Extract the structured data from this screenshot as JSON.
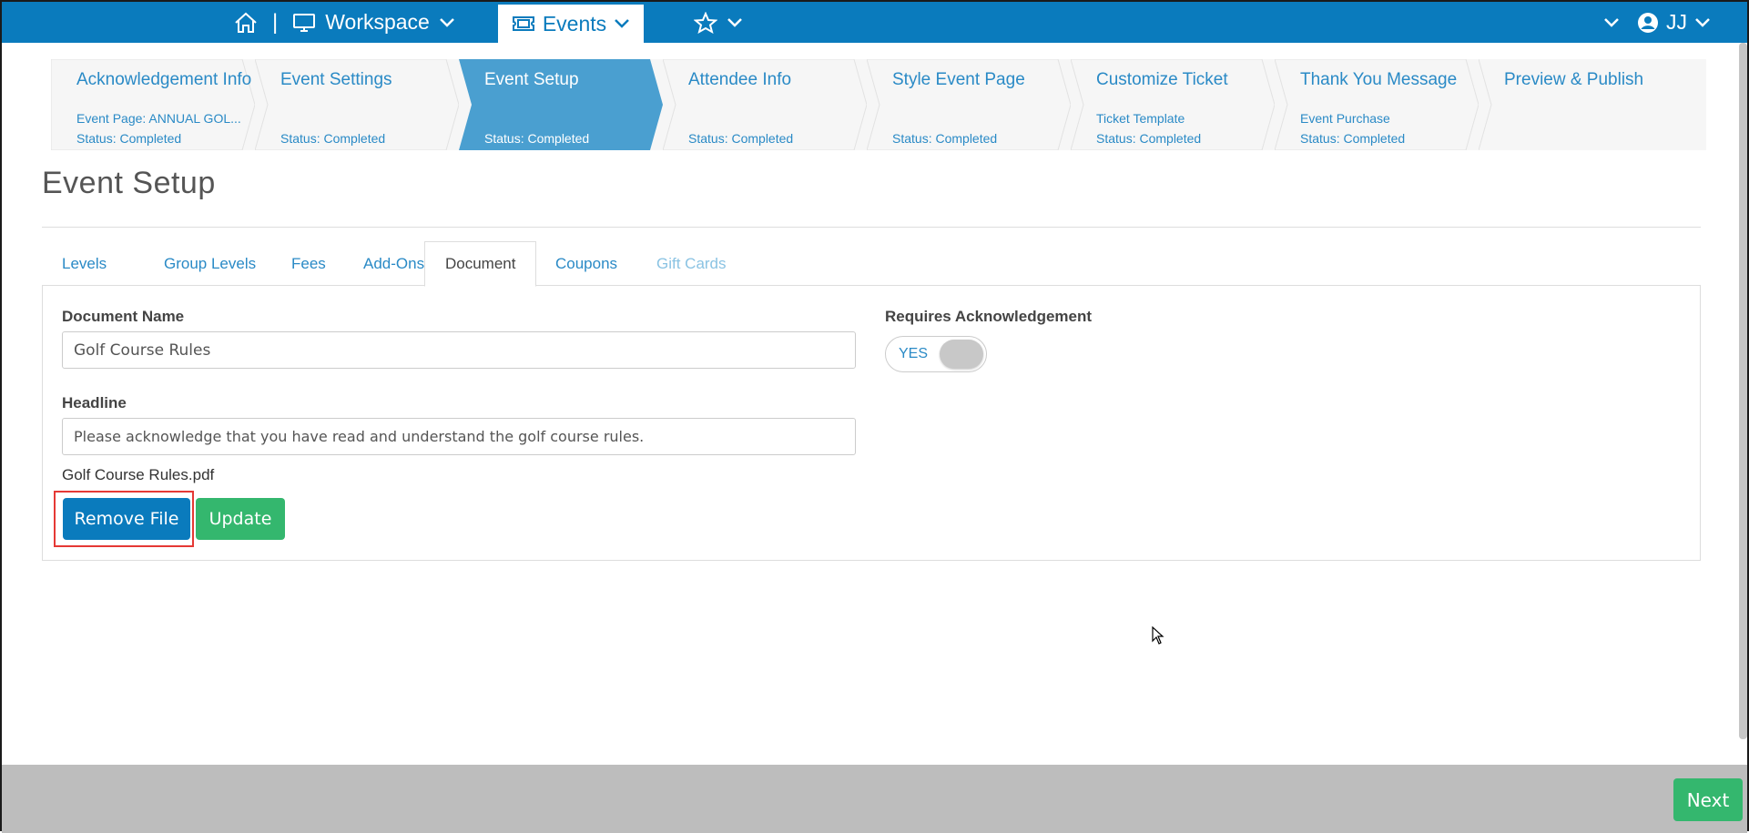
{
  "topbar": {
    "workspace_label": "Workspace",
    "events_label": "Events",
    "user_initials": "JJ"
  },
  "wizard": {
    "steps": [
      {
        "title": "Acknowledgement Info",
        "line1": "Event Page: ANNUAL GOL...",
        "line2": "Status: Completed"
      },
      {
        "title": "Event Settings",
        "line1": "",
        "line2": "Status: Completed"
      },
      {
        "title": "Event Setup",
        "line1": "",
        "line2": "Status: Completed"
      },
      {
        "title": "Attendee Info",
        "line1": "",
        "line2": "Status: Completed"
      },
      {
        "title": "Style Event Page",
        "line1": "",
        "line2": "Status: Completed"
      },
      {
        "title": "Customize Ticket",
        "line1": "Ticket Template",
        "line2": "Status: Completed"
      },
      {
        "title": "Thank You Message",
        "line1": "Event Purchase",
        "line2": "Status: Completed"
      },
      {
        "title": "Preview & Publish",
        "line1": "",
        "line2": ""
      }
    ],
    "active_index": 2
  },
  "page": {
    "title": "Event Setup"
  },
  "tabs": [
    "Levels",
    "Group Levels",
    "Fees",
    "Add-Ons",
    "Document",
    "Coupons",
    "Gift Cards"
  ],
  "form": {
    "document_name_label": "Document Name",
    "document_name_value": "Golf Course Rules",
    "headline_label": "Headline",
    "headline_value": "Please acknowledge that you have read and understand the golf course rules.",
    "requires_ack_label": "Requires Acknowledgement",
    "requires_ack_toggle": "YES",
    "file_name": "Golf Course Rules.pdf",
    "remove_file_label": "Remove File",
    "update_label": "Update"
  },
  "footer": {
    "next_label": "Next"
  },
  "colors": {
    "primary": "#0a7bbd",
    "success": "#34b76e",
    "link": "#2a8ac6",
    "highlight": "#e53935"
  }
}
